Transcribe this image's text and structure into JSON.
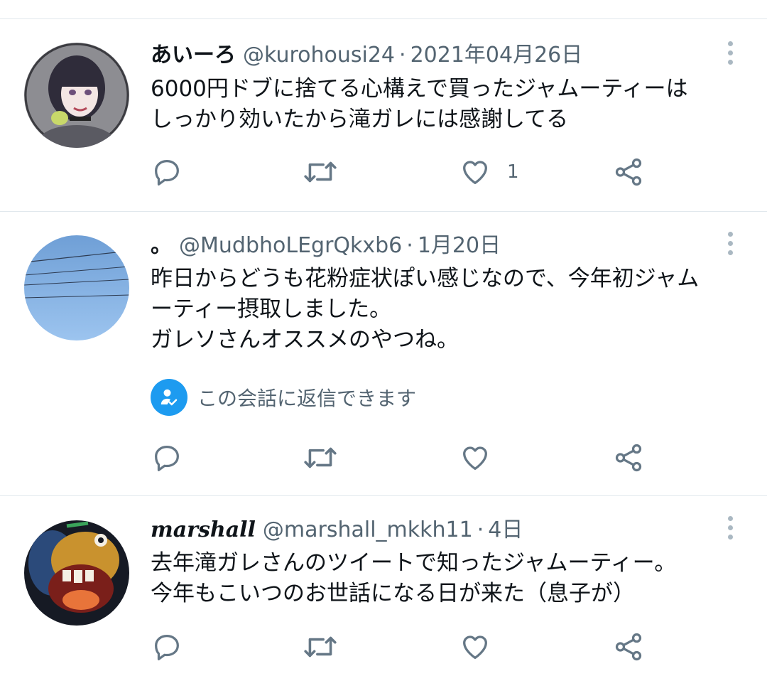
{
  "colors": {
    "text_primary": "#0f1419",
    "text_secondary": "#536471",
    "icon": "#657786",
    "divider": "#e1e8ed",
    "accent": "#1d9bf0"
  },
  "tweets": [
    {
      "display_name": "あいーろ",
      "handle": "@kurohousi24",
      "separator": "·",
      "date": "2021年04月26日",
      "avatar": "illustrated-girl-avatar",
      "lines": [
        "6000円ドブに捨てる心構えで買ったジャムーティーは",
        "しっかり効いたから滝ガレには感謝してる"
      ],
      "actions": {
        "reply_icon": "reply-icon",
        "retweet_icon": "retweet-icon",
        "like_icon": "like-icon",
        "like_count": "1",
        "share_icon": "share-icon"
      }
    },
    {
      "display_name": "。",
      "handle": "@MudbhoLEgrQkxb6",
      "separator": "·",
      "date": "1月20日",
      "avatar": "blue-sky-avatar",
      "lines": [
        "昨日からどうも花粉症状ぽい感じなので、今年初ジャム",
        "ーティー摂取しました。",
        "ガレソさんオススメのやつね。"
      ],
      "reply_restriction": "この会話に返信できます",
      "actions": {
        "reply_icon": "reply-icon",
        "retweet_icon": "retweet-icon",
        "like_icon": "like-icon",
        "share_icon": "share-icon"
      }
    },
    {
      "display_name": "marshall",
      "handle": "@marshall_mkkh11",
      "separator": "·",
      "date": "4日",
      "avatar": "cartoon-character-avatar",
      "lines": [
        "去年滝ガレさんのツイートで知ったジャムーティー。",
        "今年もこいつのお世話になる日が来た（息子が）"
      ],
      "actions": {
        "reply_icon": "reply-icon",
        "retweet_icon": "retweet-icon",
        "like_icon": "like-icon",
        "share_icon": "share-icon"
      }
    }
  ]
}
